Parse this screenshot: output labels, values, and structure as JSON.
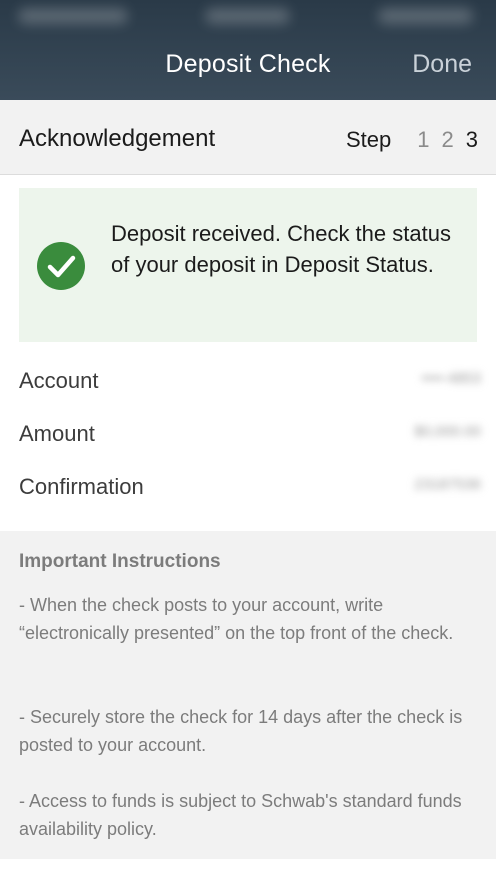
{
  "nav": {
    "title": "Deposit Check",
    "done_label": "Done"
  },
  "step_header": {
    "title": "Acknowledgement",
    "step_label": "Step",
    "steps": [
      "1",
      "2",
      "3"
    ],
    "active_step": "3"
  },
  "success": {
    "icon": "checkmark-circle-icon",
    "message": "Deposit received. Check the status of your deposit in Deposit Status.",
    "color": "#3a8c3d",
    "background": "#edf5ec"
  },
  "details": [
    {
      "label": "Account",
      "value": "••••-4853"
    },
    {
      "label": "Amount",
      "value": "$0,000.00"
    },
    {
      "label": "Confirmation",
      "value": "23187536"
    }
  ],
  "instructions": {
    "heading": "Important Instructions",
    "paragraphs": [
      "- When the check posts to your account, write “electronically presented” on the top front of the check.",
      "- Securely store the check for 14 days after the check is posted to your account.",
      "- Access to funds is subject to Schwab's standard funds availability policy."
    ]
  },
  "colors": {
    "nav_background": "#2f3f4d",
    "done_text": "#c9d1d8",
    "instructions_text": "#7c7c7c"
  }
}
